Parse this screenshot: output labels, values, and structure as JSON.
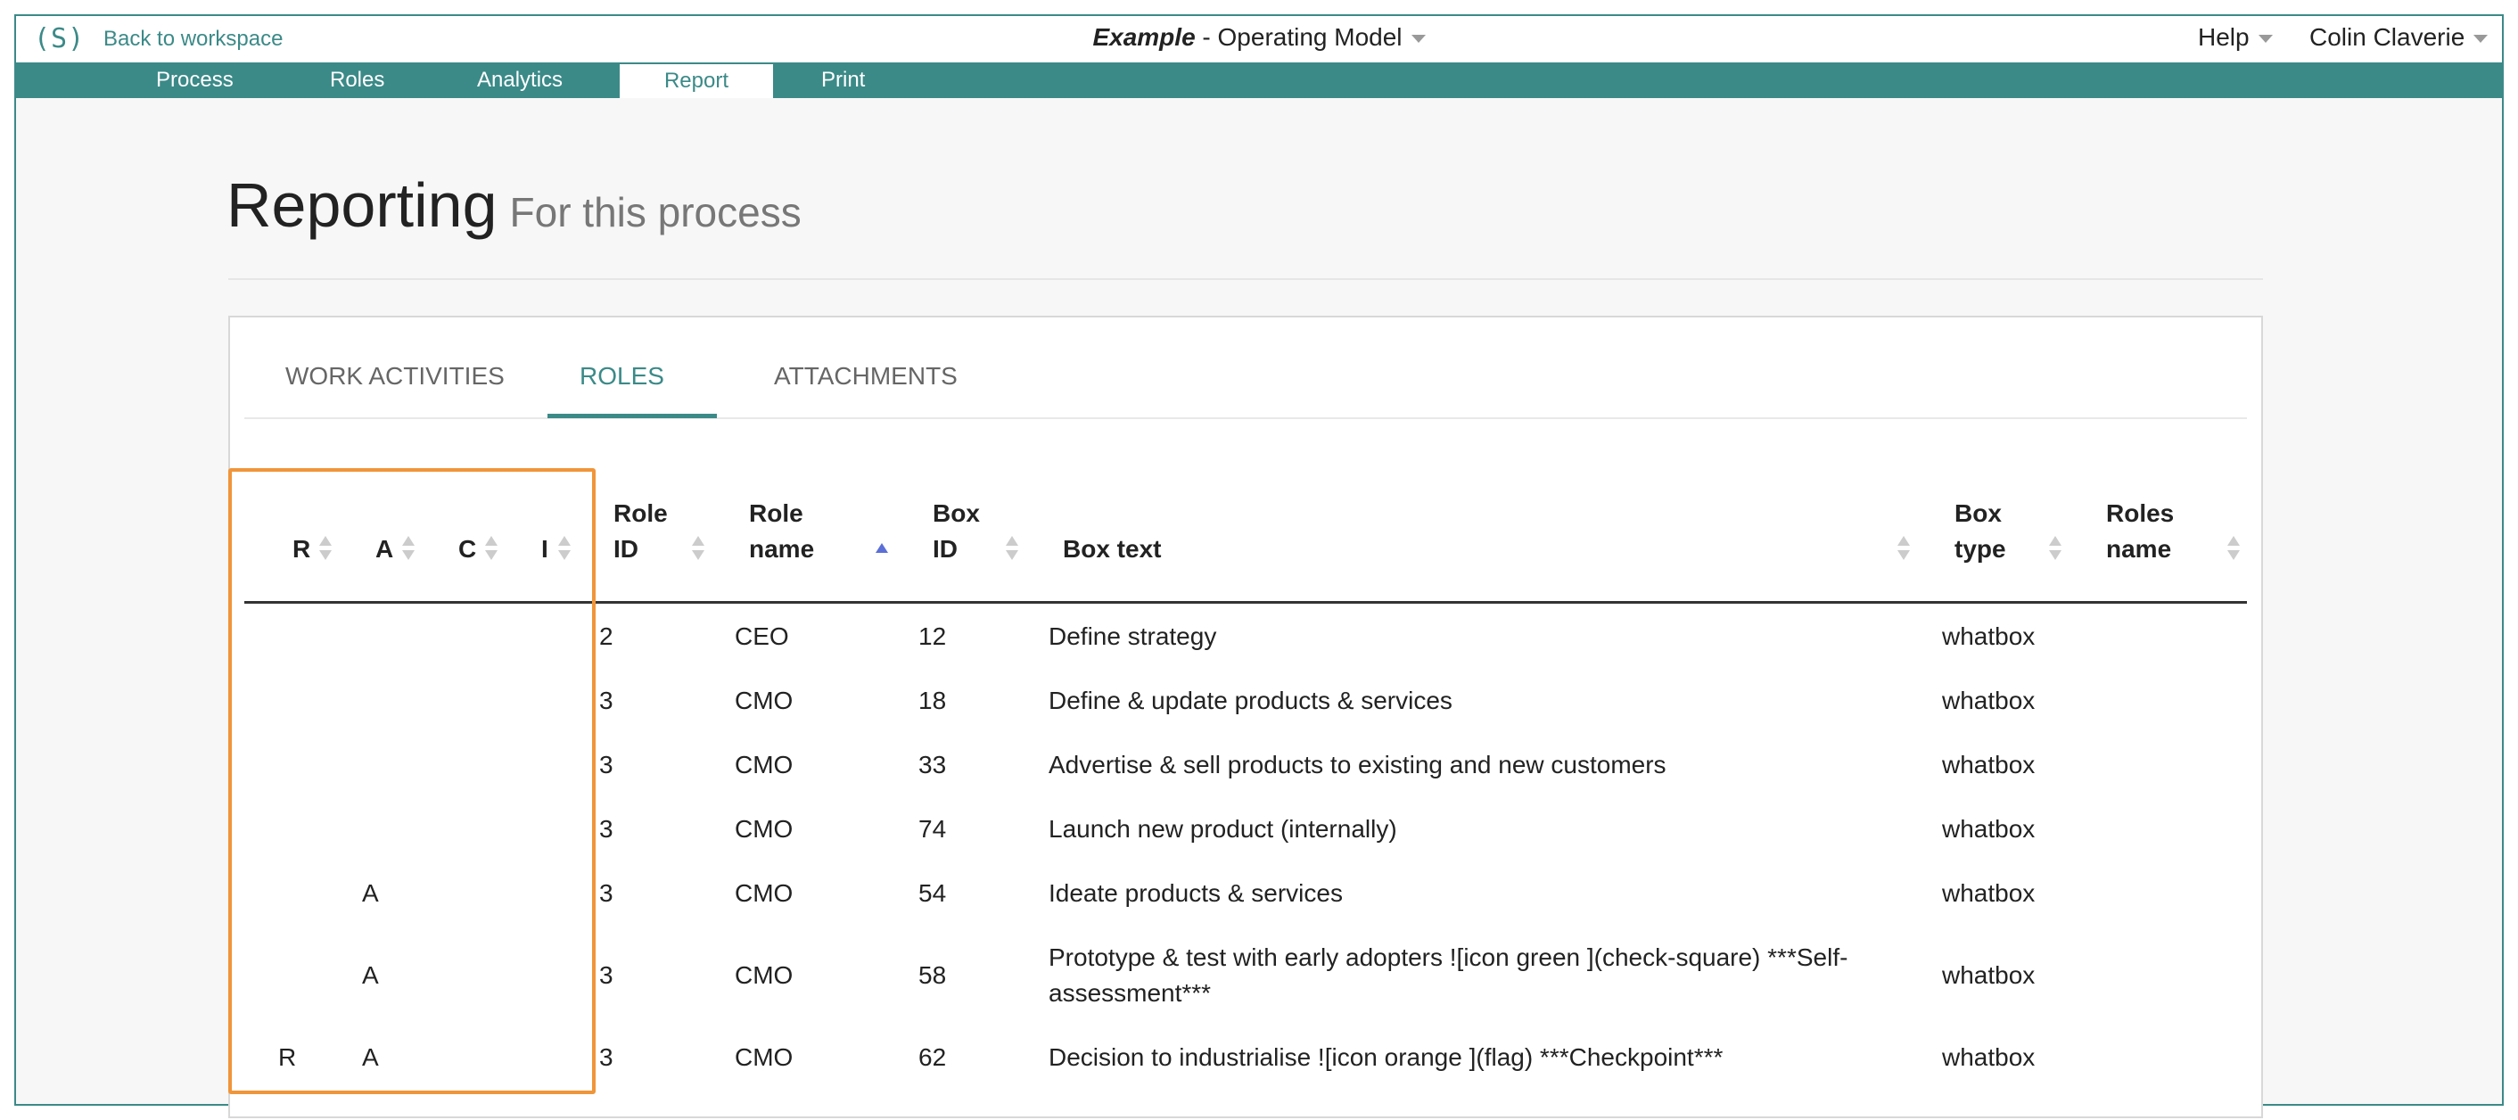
{
  "topbar": {
    "logo": "(S)",
    "back_link": "Back to workspace",
    "title_italic": "Example",
    "title_rest": " - Operating Model",
    "help": "Help",
    "user": "Colin Claverie"
  },
  "nav": {
    "items": [
      "Process",
      "Roles",
      "Analytics",
      "Report",
      "Print"
    ],
    "active": "Report"
  },
  "page": {
    "title": "Reporting",
    "subtitle": "For this process"
  },
  "tabs": {
    "items": [
      "WORK ACTIVITIES",
      "ROLES",
      "ATTACHMENTS"
    ],
    "active": "ROLES"
  },
  "table": {
    "headers": {
      "r": "R",
      "a": "A",
      "c": "C",
      "i": "I",
      "role_id_1": "Role",
      "role_id_2": "ID",
      "role_name_1": "Role",
      "role_name_2": "name",
      "box_id_1": "Box",
      "box_id_2": "ID",
      "box_text": "Box text",
      "box_type_1": "Box",
      "box_type_2": "type",
      "roles_name_1": "Roles",
      "roles_name_2": "name"
    },
    "sorted_column": "Role name",
    "rows": [
      {
        "r": "",
        "a": "",
        "c": "",
        "i": "",
        "role_id": "2",
        "role_name": "CEO",
        "box_id": "12",
        "box_text": "Define strategy",
        "box_type": "whatbox",
        "roles_name": ""
      },
      {
        "r": "",
        "a": "",
        "c": "",
        "i": "",
        "role_id": "3",
        "role_name": "CMO",
        "box_id": "18",
        "box_text": "Define & update products & services",
        "box_type": "whatbox",
        "roles_name": ""
      },
      {
        "r": "",
        "a": "",
        "c": "",
        "i": "",
        "role_id": "3",
        "role_name": "CMO",
        "box_id": "33",
        "box_text": "Advertise & sell products to existing and new customers",
        "box_type": "whatbox",
        "roles_name": ""
      },
      {
        "r": "",
        "a": "",
        "c": "",
        "i": "",
        "role_id": "3",
        "role_name": "CMO",
        "box_id": "74",
        "box_text": "Launch new product (internally)",
        "box_type": "whatbox",
        "roles_name": ""
      },
      {
        "r": "",
        "a": "A",
        "c": "",
        "i": "",
        "role_id": "3",
        "role_name": "CMO",
        "box_id": "54",
        "box_text": "Ideate products & services",
        "box_type": "whatbox",
        "roles_name": ""
      },
      {
        "r": "",
        "a": "A",
        "c": "",
        "i": "",
        "role_id": "3",
        "role_name": "CMO",
        "box_id": "58",
        "box_text": "Prototype & test with early adopters ![icon green ](check-square) ***Self-assessment***",
        "box_type": "whatbox",
        "roles_name": ""
      },
      {
        "r": "R",
        "a": "A",
        "c": "",
        "i": "",
        "role_id": "3",
        "role_name": "CMO",
        "box_id": "62",
        "box_text": "Decision to industrialise ![icon orange ](flag) ***Checkpoint***",
        "box_type": "whatbox",
        "roles_name": ""
      }
    ]
  },
  "colors": {
    "accent": "#3b8a88",
    "highlight": "#f0953a",
    "sort_active": "#5b6fd6"
  }
}
